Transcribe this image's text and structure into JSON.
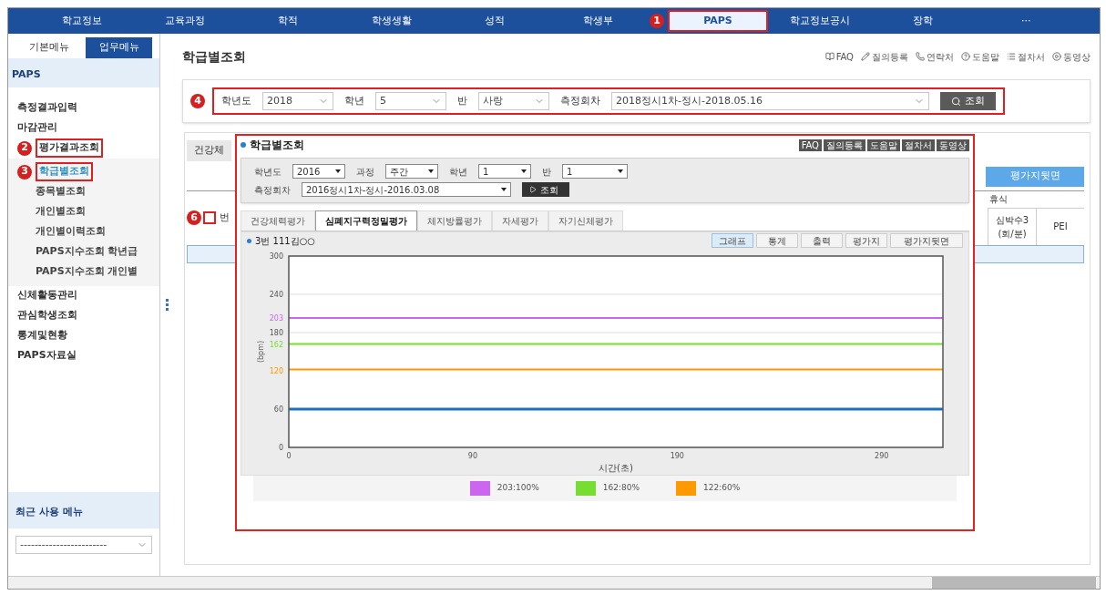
{
  "nav": {
    "items": [
      {
        "label": "학교정보",
        "selected": false
      },
      {
        "label": "교육과정",
        "selected": false
      },
      {
        "label": "학적",
        "selected": false
      },
      {
        "label": "학생생활",
        "selected": false
      },
      {
        "label": "성적",
        "selected": false
      },
      {
        "label": "학생부",
        "selected": false
      },
      {
        "label": "PAPS",
        "selected": true,
        "marker": "1"
      },
      {
        "label": "학교정보공시",
        "selected": false
      },
      {
        "label": "장학",
        "selected": false
      },
      {
        "label": "···",
        "selected": false
      }
    ]
  },
  "sidebar": {
    "tabs": [
      {
        "label": "기본메뉴",
        "selected": false
      },
      {
        "label": "업무메뉴",
        "selected": true
      }
    ],
    "section": "PAPS",
    "items": [
      {
        "label": "측정결과입력",
        "selected": false
      },
      {
        "label": "마감관리",
        "selected": false
      },
      {
        "label": "평가결과조회",
        "selected": false,
        "marker": "2",
        "children": [
          {
            "label": "학급별조회",
            "selected": true,
            "marker": "3"
          },
          {
            "label": "종목별조회",
            "selected": false
          },
          {
            "label": "개인별조회",
            "selected": false
          },
          {
            "label": "개인별이력조회",
            "selected": false
          },
          {
            "label": "PAPS지수조회 학년급",
            "selected": false
          },
          {
            "label": "PAPS지수조회 개인별",
            "selected": false
          }
        ]
      },
      {
        "label": "신체활동관리",
        "selected": false
      },
      {
        "label": "관심학생조회",
        "selected": false
      },
      {
        "label": "통계및현황",
        "selected": false
      },
      {
        "label": "PAPS자료실",
        "selected": false
      }
    ],
    "recent": {
      "title": "최근 사용 메뉴",
      "value": "------------------------"
    }
  },
  "main": {
    "title": "학급별조회",
    "links": [
      "FAQ",
      "질의등록",
      "연락처",
      "도움말",
      "절차서",
      "동영상"
    ],
    "filter": {
      "marker": "4",
      "fields": [
        {
          "label": "학년도",
          "value": "2018"
        },
        {
          "label": "학년",
          "value": "5"
        },
        {
          "label": "반",
          "value": "사랑"
        },
        {
          "label": "측정회차",
          "value": "2018정시1차-정시-2018.05.16"
        }
      ],
      "button": "조회"
    }
  },
  "background": {
    "tab": "건강체",
    "button": "평가지뒷면",
    "marker": "6",
    "checked": false,
    "first_column": "번",
    "group_header": "휴식",
    "columns": [
      "심박수3\n(회/분)",
      "PEI"
    ]
  },
  "popup": {
    "title": "학급별조회",
    "toolbar": [
      "FAQ",
      "질의등록",
      "도움말",
      "절차서",
      "동영상"
    ],
    "filters": [
      {
        "label": "학년도",
        "value": "2016"
      },
      {
        "label": "과정",
        "value": "주간"
      },
      {
        "label": "학년",
        "value": "1"
      },
      {
        "label": "반",
        "value": "1"
      }
    ],
    "round": {
      "label": "측정회차",
      "value": "2016정시1차-정시-2016.03.08"
    },
    "button": "조회",
    "tabs": [
      {
        "label": "건강체력평가",
        "selected": false
      },
      {
        "label": "심폐지구력정밀평가",
        "selected": true
      },
      {
        "label": "체지방률평가",
        "selected": false
      },
      {
        "label": "자세평가",
        "selected": false
      },
      {
        "label": "자기신체평가",
        "selected": false
      }
    ],
    "student": "3번 111김○○",
    "views": [
      {
        "label": "그래프",
        "selected": true
      },
      {
        "label": "통계",
        "selected": false
      },
      {
        "label": "출력",
        "selected": false
      },
      {
        "label": "평가지",
        "selected": false
      },
      {
        "label": "평가지뒷면",
        "selected": false
      }
    ],
    "chart_data": {
      "type": "line",
      "xlabel": "시간(초)",
      "ylabel": "(bpm)",
      "x": [
        0,
        320
      ],
      "xlim": [
        0,
        320
      ],
      "ylim": [
        0,
        300
      ],
      "xticks": [
        0,
        90,
        190,
        290
      ],
      "yticks": [
        0,
        60,
        120,
        162,
        180,
        203,
        240,
        300
      ],
      "grid": true,
      "series": [
        {
          "name": "203:100%",
          "color": "#cc66ee",
          "values": [
            203,
            203
          ]
        },
        {
          "name": "162:80%",
          "color": "#77dd33",
          "values": [
            162,
            162
          ]
        },
        {
          "name": "122:60%",
          "color": "#ff9900",
          "values": [
            122,
            122
          ]
        },
        {
          "color": "#1f6fbf",
          "values": [
            60,
            60
          ]
        }
      ]
    }
  }
}
